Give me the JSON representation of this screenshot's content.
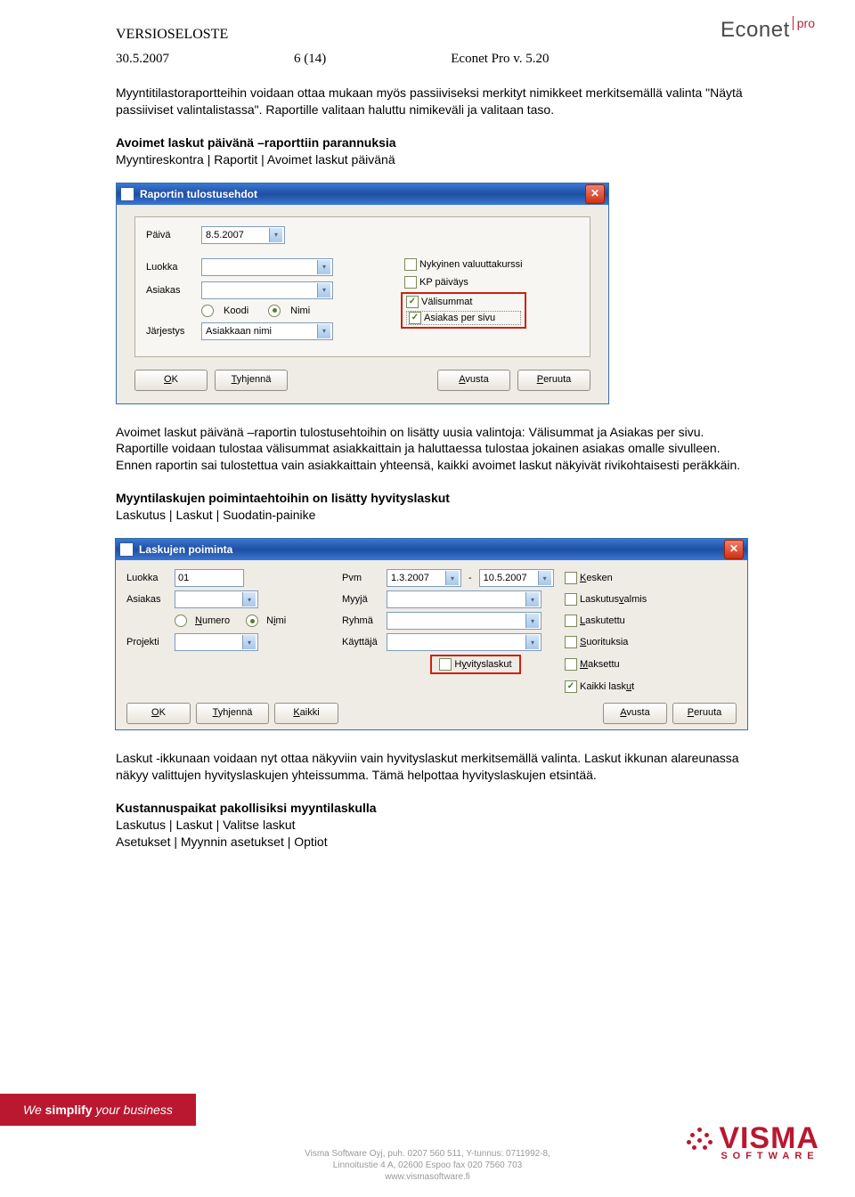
{
  "header": {
    "doc_type": "VERSIOSELOSTE",
    "date": "30.5.2007",
    "page": "6 (14)",
    "product": "Econet Pro v. 5.20"
  },
  "logo": {
    "name": "Econet",
    "suffix": "pro"
  },
  "para1": "Myyntitilastoraportteihin voidaan ottaa mukaan myös passiiviseksi merkityt nimikkeet merkitsemällä valinta \"Näytä passiiviset valintalistassa\". Raportille valitaan haluttu nimikeväli ja valitaan taso.",
  "h1": "Avoimet laskut päivänä –raporttiin parannuksia",
  "path1": "Myyntireskontra | Raportit | Avoimet laskut päivänä",
  "dialog1": {
    "title": "Raportin tulostusehdot",
    "labels": {
      "pvm": "Päivä",
      "luokka": "Luokka",
      "asiakas": "Asiakas",
      "jarjestys": "Järjestys",
      "koodi": "Koodi",
      "nimi": "Nimi"
    },
    "values": {
      "pvm": "8.5.2007",
      "jarjestys": "Asiakkaan nimi"
    },
    "checks": {
      "c1": "Nykyinen valuuttakurssi",
      "c2": "KP päiväys",
      "c3": "Välisummat",
      "c4": "Asiakas per sivu"
    },
    "buttons": {
      "ok": "OK",
      "tyhj": "Tyhjennä",
      "avusta": "Avusta",
      "peruuta": "Peruuta"
    }
  },
  "para2": "Avoimet laskut päivänä –raportin tulostusehtoihin on lisätty uusia valintoja: Välisummat ja  Asiakas per sivu. Raportille voidaan tulostaa välisummat asiakkaittain ja haluttaessa tulostaa jokainen asiakas omalle sivulleen. Ennen raportin sai tulostettua vain asiakkaittain yhteensä, kaikki avoimet laskut näkyivät rivikohtaisesti peräkkäin.",
  "h2": "Myyntilaskujen poimintaehtoihin on lisätty hyvityslaskut",
  "path2": "Laskutus | Laskut | Suodatin-painike",
  "dialog2": {
    "title": "Laskujen poiminta",
    "labels": {
      "luokka": "Luokka",
      "asiakas": "Asiakas",
      "projekti": "Projekti",
      "numero": "Numero",
      "nimi": "Nimi",
      "pvm": "Pvm",
      "myyja": "Myyjä",
      "ryhma": "Ryhmä",
      "kayttaja": "Käyttäjä",
      "hyvitys": "Hyvityslaskut"
    },
    "values": {
      "luokka": "01",
      "pvm1": "1.3.2007",
      "sep": "-",
      "pvm2": "10.5.2007"
    },
    "checks": {
      "kesken": "Kesken",
      "valmis": "Laskutusvalmis",
      "laskutettu": "Laskutettu",
      "suorituksia": "Suorituksia",
      "maksettu": "Maksettu",
      "kaikki": "Kaikki laskut"
    },
    "buttons": {
      "ok": "OK",
      "tyhj": "Tyhjennä",
      "kaikki": "Kaikki",
      "avusta": "Avusta",
      "peruuta": "Peruuta"
    }
  },
  "para3": "Laskut -ikkunaan voidaan nyt ottaa näkyviin vain hyvityslaskut merkitsemällä valinta. Laskut ikkunan alareunassa näkyy valittujen hyvityslaskujen yhteissumma. Tämä helpottaa hyvityslaskujen etsintää.",
  "h3": "Kustannuspaikat pakollisiksi myyntilaskulla",
  "path3a": "Laskutus | Laskut | Valitse laskut",
  "path3b": "Asetukset | Myynnin asetukset | Optiot",
  "tagline": {
    "we": "We ",
    "simplify": "simplify",
    "rest": " your business"
  },
  "visma": {
    "name": "VISMA",
    "sw": "SOFTWARE"
  },
  "footer": {
    "l1": "Visma Software Oyj, puh. 0207 560 511, Y-tunnus: 0711992-8,",
    "l2": "Linnoitustie 4 A, 02600 Espoo  fax 020 7560 703",
    "l3": "www.vismasoftware.fi"
  }
}
